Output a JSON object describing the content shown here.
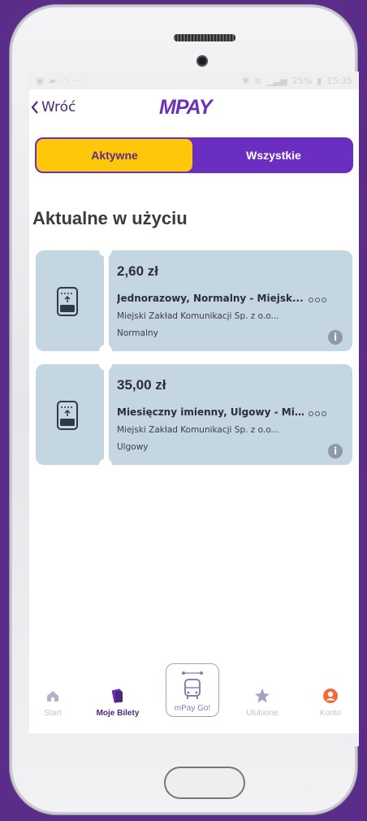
{
  "statusbar": {
    "left_icons": [
      "gallery-icon",
      "chat-icon",
      "message-icon",
      "more-icon"
    ],
    "right_text": "25%",
    "time": "15:35"
  },
  "header": {
    "back_label": "Wróć",
    "logo_text": "MPAY"
  },
  "segment": {
    "active_label": "Aktywne",
    "all_label": "Wszystkie"
  },
  "section_title": "Aktualne w użyciu",
  "tickets": [
    {
      "price": "2,60 zł",
      "name": "Jednorazowy, Normalny - Miejsk...",
      "company": "Miejski Zakład Komunikacji Sp. z o.o...",
      "type": "Normalny",
      "info": "i"
    },
    {
      "price": "35,00 zł",
      "name": "Miesięczny imienny, Ulgowy - Mi...",
      "company": "Miejski Zakład Komunikacji Sp. z o.o...",
      "type": "Ulgowy",
      "info": "i"
    }
  ],
  "tabbar": {
    "start": "Start",
    "tickets": "Moje Bilety",
    "go": "mPay Go!",
    "favorites": "Ulubione",
    "account": "Konto"
  },
  "colors": {
    "brand_purple": "#6a2fc1",
    "accent_yellow": "#ffc709",
    "ticket_bg": "#c3d6e1",
    "background": "#5b2d8a",
    "account_orange": "#f26b3a"
  }
}
